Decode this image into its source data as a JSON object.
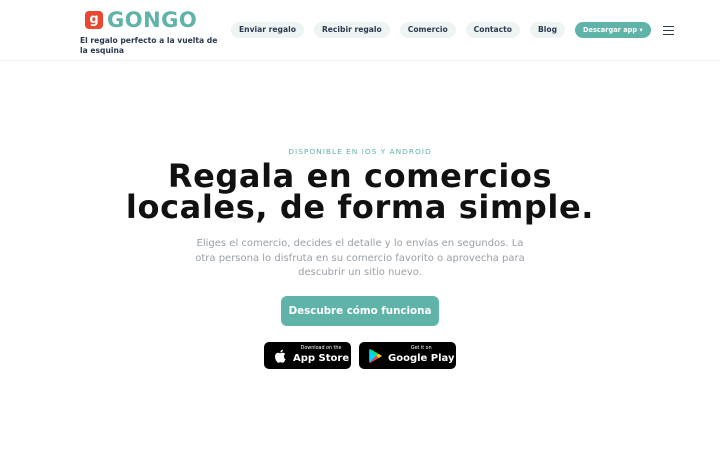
{
  "brand": {
    "logo_mark": "g",
    "name": "GONGO",
    "tagline": "El regalo perfecto a la vuelta de la esquina",
    "colors": {
      "accent": "#5fb3a9",
      "logo_mark": "#e8482f",
      "text_dark": "#2a3a4e"
    }
  },
  "nav": {
    "items": [
      {
        "label": "Enviar regalo"
      },
      {
        "label": "Recibir regalo"
      },
      {
        "label": "Comercio"
      },
      {
        "label": "Contacto"
      },
      {
        "label": "Blog"
      }
    ],
    "download_label": "Descargar app ▾",
    "menu_icon": "hamburger-menu-icon"
  },
  "hero": {
    "eyebrow": "DISPONIBLE EN IOS Y ANDROID",
    "headline_line1": "Regala en comercios",
    "headline_line2": "locales, de forma simple.",
    "subtitle": "Eliges el comercio, decides el detalle y lo envías en segundos. La otra persona lo disfruta en su comercio favorito o aprovecha para descubrir un sitio nuevo.",
    "cta_label": "Descubre cómo funciona"
  },
  "stores": {
    "app_store": {
      "small": "Download on the",
      "big": "App Store",
      "icon": "apple-icon"
    },
    "google_play": {
      "small": "Get it on",
      "big": "Google Play",
      "icon": "google-play-icon"
    }
  }
}
